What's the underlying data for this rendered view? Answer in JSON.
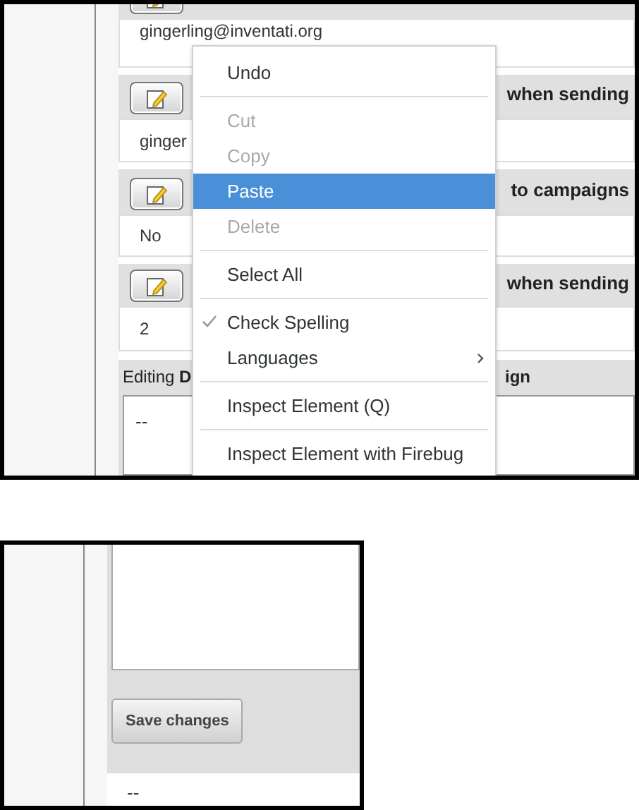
{
  "top_view": {
    "rows": [
      {
        "value": "gingerling@inventati.org"
      },
      {
        "header": "when sending",
        "value": "ginger"
      },
      {
        "header": "to campaigns",
        "value": "No"
      },
      {
        "header": "when sending",
        "value": "2"
      }
    ],
    "editing": {
      "label": "Editing",
      "bold_left": "D",
      "bold_right": "ign",
      "value": "--"
    },
    "context_menu": [
      {
        "kind": "item",
        "label": "Undo",
        "disabled": false,
        "selected": false,
        "checked": false
      },
      {
        "kind": "separator"
      },
      {
        "kind": "item",
        "label": "Cut",
        "disabled": true,
        "selected": false,
        "checked": false
      },
      {
        "kind": "item",
        "label": "Copy",
        "disabled": true,
        "selected": false,
        "checked": false
      },
      {
        "kind": "item",
        "label": "Paste",
        "disabled": false,
        "selected": true,
        "checked": false
      },
      {
        "kind": "item",
        "label": "Delete",
        "disabled": true,
        "selected": false,
        "checked": false
      },
      {
        "kind": "separator"
      },
      {
        "kind": "item",
        "label": "Select All",
        "disabled": false,
        "selected": false,
        "checked": false
      },
      {
        "kind": "separator"
      },
      {
        "kind": "item",
        "label": "Check Spelling",
        "disabled": false,
        "selected": false,
        "checked": true
      },
      {
        "kind": "submenu",
        "label": "Languages",
        "disabled": false,
        "selected": false,
        "checked": false
      },
      {
        "kind": "separator"
      },
      {
        "kind": "item",
        "label": "Inspect Element (Q)",
        "disabled": false,
        "selected": false,
        "checked": false
      },
      {
        "kind": "separator"
      },
      {
        "kind": "item",
        "label": "Inspect Element with Firebug",
        "disabled": false,
        "selected": false,
        "checked": false
      }
    ]
  },
  "bottom_view": {
    "save_button": "Save changes",
    "value": "--"
  }
}
